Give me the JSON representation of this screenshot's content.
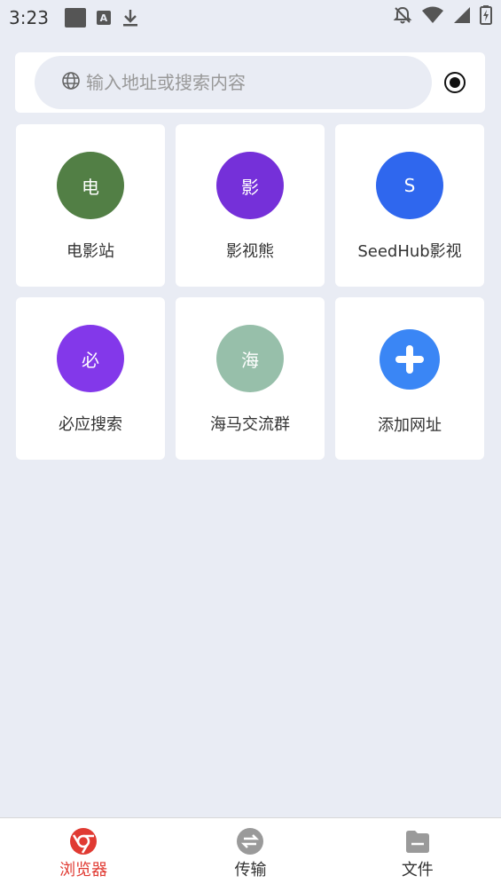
{
  "status_bar": {
    "time": "3:23",
    "icons": [
      "square-notification-icon",
      "a-notification-icon",
      "download-icon",
      "mute-bell-icon",
      "wifi-icon",
      "signal-icon",
      "battery-charging-icon"
    ]
  },
  "search": {
    "placeholder": "输入地址或搜索内容",
    "icon": "globe-icon",
    "action_icon": "record-icon"
  },
  "tiles": [
    {
      "label": "电影站",
      "initial": "电",
      "color": "#527f45"
    },
    {
      "label": "影视熊",
      "initial": "影",
      "color": "#7530d9"
    },
    {
      "label": "SeedHub影视",
      "initial": "S",
      "color": "#2f67ee"
    },
    {
      "label": "必应搜索",
      "initial": "必",
      "color": "#8338ea"
    },
    {
      "label": "海马交流群",
      "initial": "海",
      "color": "#97bfaa"
    },
    {
      "label": "添加网址",
      "initial": "",
      "color": "#3a86f5"
    }
  ],
  "bottom_nav": {
    "items": [
      {
        "label": "浏览器",
        "icon": "browser-icon",
        "active": true
      },
      {
        "label": "传输",
        "icon": "transfer-icon",
        "active": false
      },
      {
        "label": "文件",
        "icon": "folder-icon",
        "active": false
      }
    ],
    "active_color": "#e03a32"
  }
}
